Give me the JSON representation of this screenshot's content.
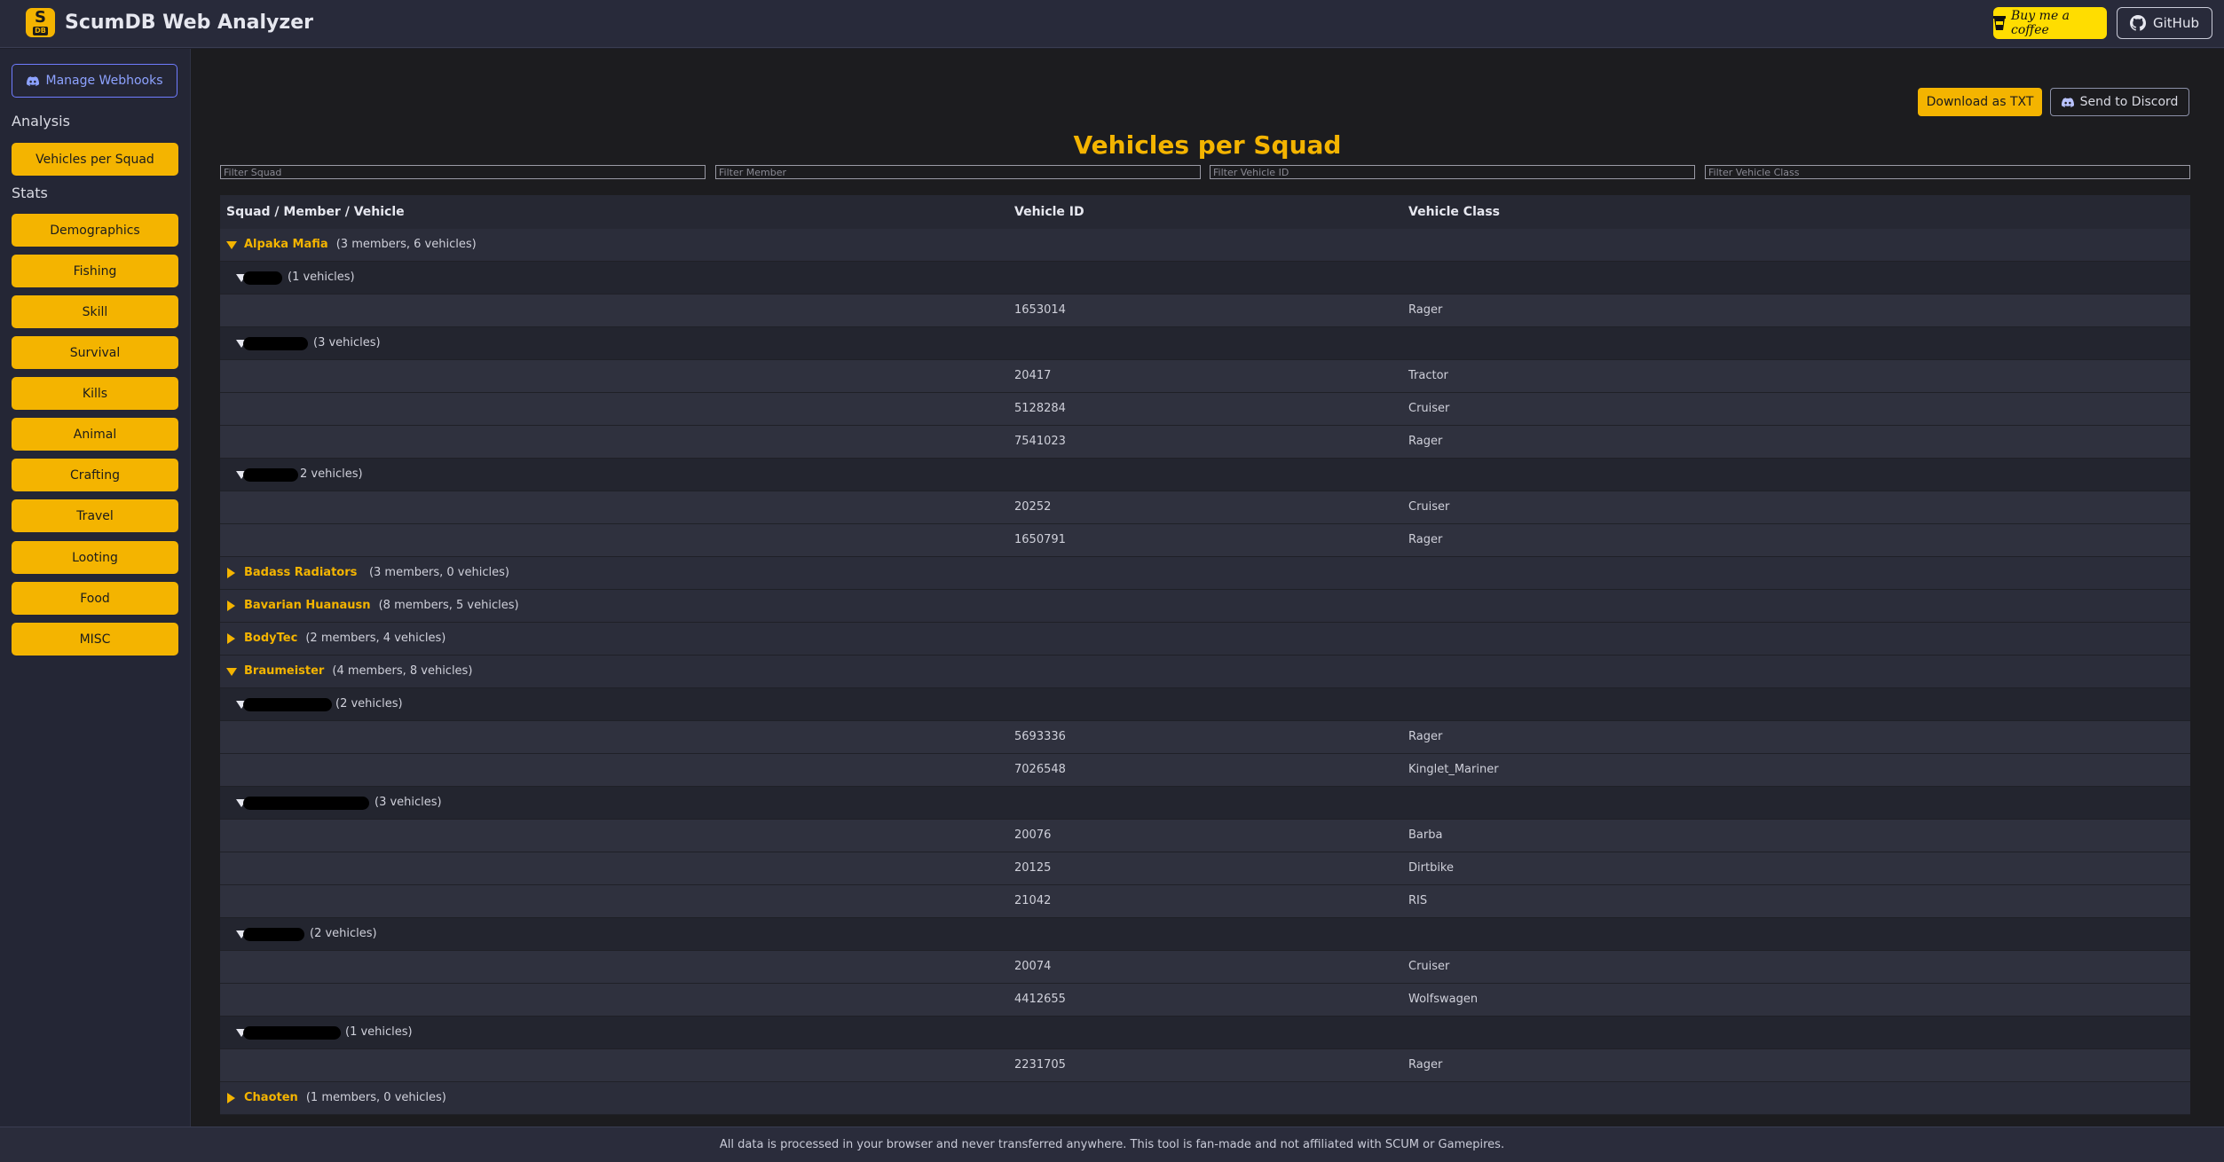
{
  "header": {
    "logo_letter": "S",
    "logo_sub": "DB",
    "title": "ScumDB Web Analyzer",
    "coffee_label": "Buy me a coffee",
    "github_label": "GitHub"
  },
  "sidebar": {
    "webhooks_label": "Manage Webhooks",
    "analysis_label": "Analysis",
    "analysis_items": [
      "Vehicles per Squad"
    ],
    "stats_label": "Stats",
    "stats_items": [
      "Demographics",
      "Fishing",
      "Skill",
      "Survival",
      "Kills",
      "Animal",
      "Crafting",
      "Travel",
      "Looting",
      "Food",
      "MISC"
    ]
  },
  "toolbar": {
    "download_label": "Download as TXT",
    "discord_label": "Send to Discord"
  },
  "page_title": "Vehicles per Squad",
  "filters": {
    "squad": "Filter Squad",
    "member": "Filter Member",
    "vehicle_id": "Filter Vehicle ID",
    "vehicle_class": "Filter Vehicle Class"
  },
  "columns": [
    "Squad / Member / Vehicle",
    "Vehicle ID",
    "Vehicle Class"
  ],
  "rows": [
    {
      "type": "squad",
      "expanded": true,
      "name": "Alpaka Mafia",
      "meta": "(3 members, 6 vehicles)"
    },
    {
      "type": "member",
      "meta": "(1 vehicles)"
    },
    {
      "type": "vehicle",
      "id": "1653014",
      "class": "Rager"
    },
    {
      "type": "member",
      "meta": "(3 vehicles)"
    },
    {
      "type": "vehicle",
      "id": "20417",
      "class": "Tractor"
    },
    {
      "type": "vehicle",
      "id": "5128284",
      "class": "Cruiser"
    },
    {
      "type": "vehicle",
      "id": "7541023",
      "class": "Rager"
    },
    {
      "type": "member",
      "meta": "2 vehicles)"
    },
    {
      "type": "vehicle",
      "id": "20252",
      "class": "Cruiser"
    },
    {
      "type": "vehicle",
      "id": "1650791",
      "class": "Rager"
    },
    {
      "type": "squad",
      "expanded": false,
      "name": "Badass Radiators",
      "meta": "(3 members, 0 vehicles)"
    },
    {
      "type": "squad",
      "expanded": false,
      "name": "Bavarian Huanausn",
      "meta": "(8 members, 5 vehicles)"
    },
    {
      "type": "squad",
      "expanded": false,
      "name": "BodyTec",
      "meta": "(2 members, 4 vehicles)"
    },
    {
      "type": "squad",
      "expanded": true,
      "name": "Braumeister",
      "meta": "(4 members, 8 vehicles)"
    },
    {
      "type": "member",
      "meta": "(2 vehicles)"
    },
    {
      "type": "vehicle",
      "id": "5693336",
      "class": "Rager"
    },
    {
      "type": "vehicle",
      "id": "7026548",
      "class": "Kinglet_Mariner"
    },
    {
      "type": "member",
      "meta": "(3 vehicles)"
    },
    {
      "type": "vehicle",
      "id": "20076",
      "class": "Barba"
    },
    {
      "type": "vehicle",
      "id": "20125",
      "class": "Dirtbike"
    },
    {
      "type": "vehicle",
      "id": "21042",
      "class": "RIS"
    },
    {
      "type": "member",
      "meta": "(2 vehicles)"
    },
    {
      "type": "vehicle",
      "id": "20074",
      "class": "Cruiser"
    },
    {
      "type": "vehicle",
      "id": "4412655",
      "class": "Wolfswagen"
    },
    {
      "type": "member",
      "meta": "(1 vehicles)"
    },
    {
      "type": "vehicle",
      "id": "2231705",
      "class": "Rager"
    },
    {
      "type": "squad",
      "expanded": false,
      "name": "Chaoten",
      "meta": "(1 members, 0 vehicles)"
    }
  ],
  "footer": "All data is processed in your browser and never transferred anywhere. This tool is fan-made and not affiliated with SCUM or Gamepires.",
  "colors": {
    "accent": "#f4b400",
    "discord": "#5865f2",
    "background": "#1e1f2b"
  }
}
